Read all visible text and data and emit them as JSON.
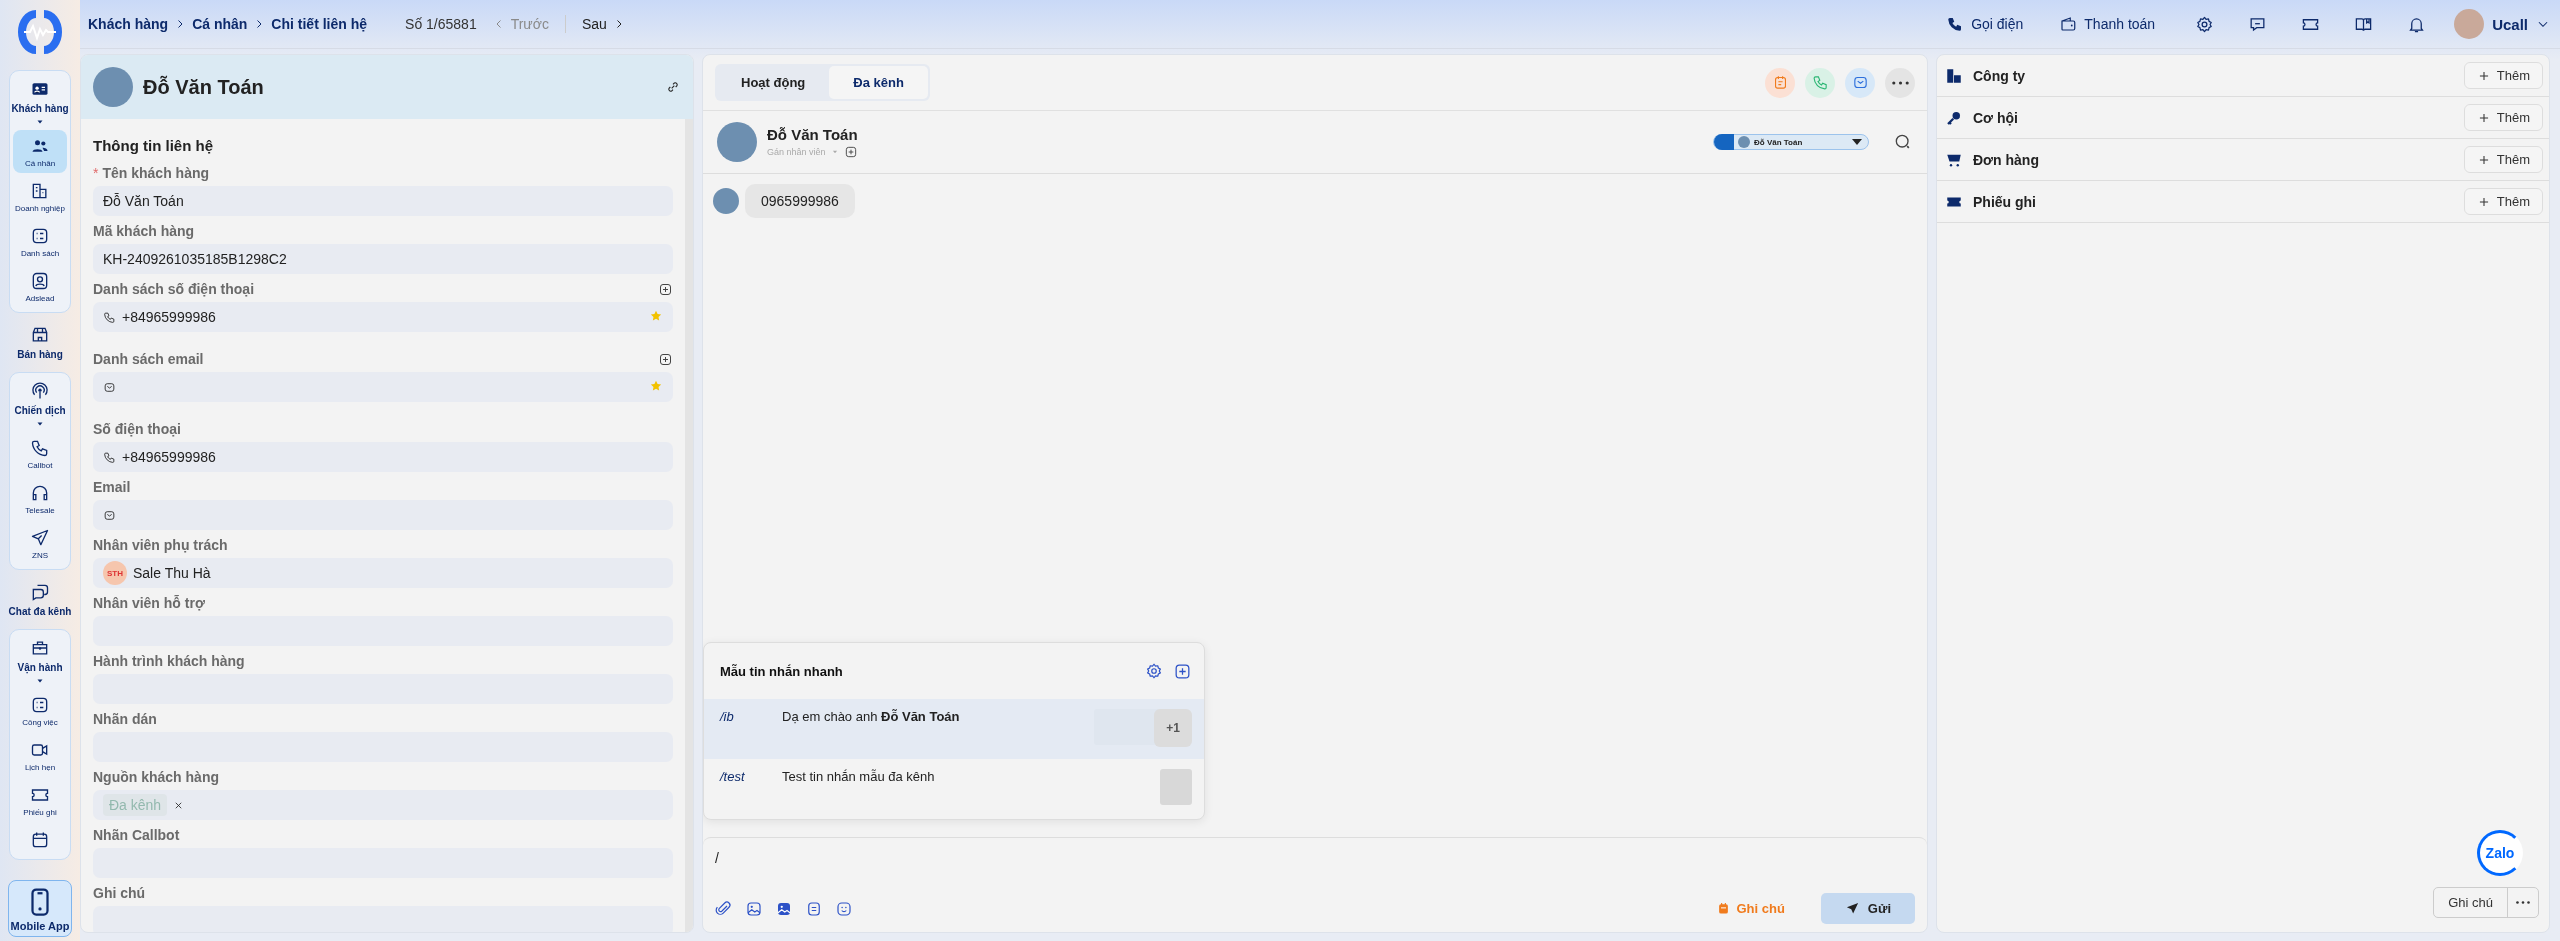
{
  "sidebar": {
    "sections": [
      {
        "kind": "group",
        "label": "Khách hàng",
        "expanded": true,
        "items": [
          {
            "label": "Cá nhân",
            "selected": true
          },
          {
            "label": "Doanh nghiệp",
            "selected": false
          },
          {
            "label": "Danh sách",
            "selected": false
          },
          {
            "label": "Adslead",
            "selected": false
          }
        ]
      },
      {
        "kind": "single",
        "label": "Bán hàng"
      },
      {
        "kind": "group",
        "label": "Chiến dịch",
        "expanded": true,
        "items": [
          {
            "label": "Callbot",
            "selected": false
          },
          {
            "label": "Telesale",
            "selected": false
          },
          {
            "label": "ZNS",
            "selected": false
          }
        ]
      },
      {
        "kind": "single",
        "label": "Chat đa kênh"
      },
      {
        "kind": "group",
        "label": "Vận hành",
        "expanded": true,
        "items": [
          {
            "label": "Công việc",
            "selected": false
          },
          {
            "label": "Lịch hẹn",
            "selected": false
          },
          {
            "label": "Phiếu ghi",
            "selected": false
          },
          {
            "selected": false
          }
        ]
      },
      {
        "kind": "highlight",
        "label": "Mobile App"
      }
    ]
  },
  "top_bar": {
    "breadcrumb": [
      "Khách hàng",
      "Cá nhân",
      "Chi tiết liên hệ"
    ],
    "record": "Số 1/65881",
    "prev": {
      "label": "Trước",
      "disabled": true
    },
    "next": {
      "label": "Sau",
      "disabled": false
    },
    "actions": [
      "Gọi điện",
      "Thanh toán"
    ],
    "user": {
      "name": "Ucall"
    }
  },
  "contact_panel": {
    "name": "Đỗ Văn Toán",
    "section_title": "Thông tin liên hệ",
    "fields": [
      {
        "kind": "text",
        "label": "Tên khách hàng",
        "required_mark": "*",
        "value": "Đỗ Văn Toán"
      },
      {
        "kind": "text",
        "label": "Mã khách hàng",
        "value": "KH-2409261035185B1298C2"
      },
      {
        "kind": "phone_list",
        "label": "Danh sách số điện thoại",
        "value": "+84965999986",
        "primary": true
      },
      {
        "kind": "email_list",
        "label": "Danh sách email",
        "primary": true
      },
      {
        "kind": "phone",
        "label": "Số điện thoại",
        "value": "+84965999986"
      },
      {
        "kind": "email",
        "label": "Email"
      },
      {
        "kind": "person",
        "label": "Nhân viên phụ trách",
        "initials": "STH",
        "value": "Sale Thu Hà"
      },
      {
        "kind": "text",
        "label": "Nhân viên hỗ trợ"
      },
      {
        "kind": "text",
        "label": "Hành trình khách hàng"
      },
      {
        "kind": "text",
        "label": "Nhãn dán"
      },
      {
        "kind": "tags",
        "label": "Nguồn khách hàng",
        "tags": [
          "Đa kênh"
        ]
      },
      {
        "kind": "text",
        "label": "Nhãn Callbot"
      },
      {
        "kind": "text",
        "label": "Ghi chú"
      }
    ]
  },
  "conversation": {
    "tabs": [
      {
        "label": "Hoạt động",
        "selected": false
      },
      {
        "label": "Đa kênh",
        "selected": true
      }
    ],
    "header": {
      "name": "Đỗ Văn Toán",
      "assign": "Gán nhân viên",
      "channel_contact": "Đỗ Văn Toán"
    },
    "messages": [
      {
        "text": "0965999986"
      }
    ],
    "quick_templates": {
      "title": "Mẫu tin nhắn nhanh",
      "items": [
        {
          "shortcut": "/ib",
          "text": "Dạ em chào anh **Đỗ Văn Toán**",
          "selected": true,
          "extra": "+1"
        },
        {
          "shortcut": "/test",
          "text": "Test tin nhắn mẫu đa kênh",
          "selected": false
        }
      ]
    },
    "composer": {
      "value": "/",
      "note_button": "Ghi chú",
      "send_button": "Gửi"
    }
  },
  "related_panel": {
    "sections": [
      {
        "label": "Công ty",
        "button": "Thêm"
      },
      {
        "label": "Cơ hội",
        "button": "Thêm"
      },
      {
        "label": "Đơn hàng",
        "button": "Thêm"
      },
      {
        "label": "Phiếu ghi",
        "button": "Thêm"
      }
    ],
    "footer": {
      "note_button": "Ghi chú",
      "badge": "Zalo"
    }
  }
}
